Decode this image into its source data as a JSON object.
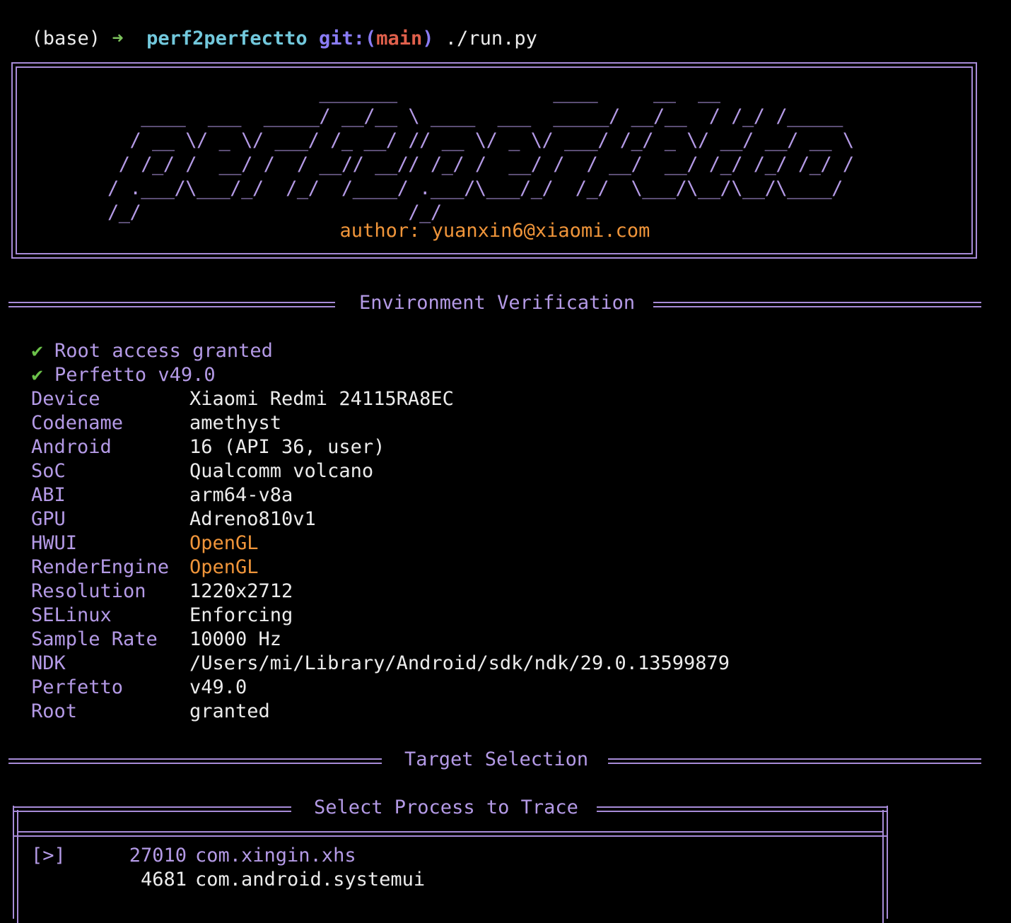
{
  "prompt": {
    "env": "(base)",
    "arrow": "➜",
    "dir": "perf2perfectto",
    "git_label": "git:(",
    "branch": "main",
    "git_close": ")",
    "command": "./run.py"
  },
  "banner": {
    "ascii_art": "                   _______              ____     __  __\n   ____  ___  _____/ __/__ \\ ____  ___  _____/ __/__  / /_/ /_____\n  / __ \\/ _ \\/ ___/ /_ __/ // __ \\/ _ \\/ ___/ /_/ _ \\/ __/ __/ __ \\\n / /_/ /  __/ /  / __// __// /_/ /  __/ /  / __/  __/ /_/ /_/ /_/ /\n/ .___/\\___/_/  /_/  /____/ .___/\\___/_/  /_/  \\___/\\__/\\__/\\____/\n/_/                        /_/",
    "author": "author: yuanxin6@xiaomi.com"
  },
  "sections": {
    "environment_title": "Environment Verification",
    "target_title": "Target Selection",
    "process_panel_title": "Select Process to Trace"
  },
  "checks": [
    {
      "icon": "✔",
      "text": "Root access granted"
    },
    {
      "icon": "✔",
      "text": "Perfetto v49.0"
    }
  ],
  "environment": [
    {
      "key": "Device",
      "value": "Xiaomi Redmi 24115RA8EC"
    },
    {
      "key": "Codename",
      "value": "amethyst"
    },
    {
      "key": "Android",
      "value": "16 (API 36, user)"
    },
    {
      "key": "SoC",
      "value": "Qualcomm volcano"
    },
    {
      "key": "ABI",
      "value": "arm64-v8a"
    },
    {
      "key": "GPU",
      "value": "Adreno810v1"
    },
    {
      "key": "HWUI",
      "value": "OpenGL"
    },
    {
      "key": "RenderEngine",
      "value": "OpenGL"
    },
    {
      "key": "Resolution",
      "value": "1220x2712"
    },
    {
      "key": "SELinux",
      "value": "Enforcing"
    },
    {
      "key": "Sample Rate",
      "value": "10000 Hz"
    },
    {
      "key": "NDK",
      "value": "/Users/mi/Library/Android/sdk/ndk/29.0.13599879"
    },
    {
      "key": "Perfetto",
      "value": "v49.0"
    },
    {
      "key": "Root",
      "value": "granted"
    }
  ],
  "processes": [
    {
      "marker": "[>]",
      "pid": "27010",
      "name": "com.xingin.xhs",
      "selected": true
    },
    {
      "marker": "",
      "pid": "4681",
      "name": "com.android.systemui",
      "selected": false
    }
  ],
  "colors": {
    "background": "#000000",
    "accent_purple": "#b49ae6",
    "highlight_orange": "#f0953a",
    "check_green": "#6cc24a",
    "dir_cyan": "#72c8dc",
    "branch_red": "#e0604c"
  }
}
